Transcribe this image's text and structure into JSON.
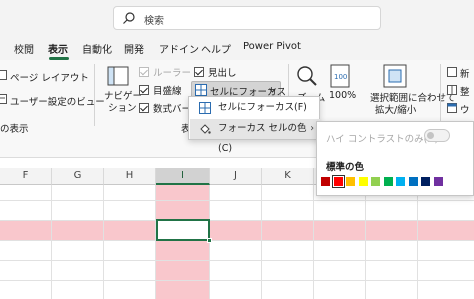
{
  "search": {
    "placeholder": "検索"
  },
  "tabs": [
    {
      "label": "校閲",
      "active": false
    },
    {
      "label": "表示",
      "active": true
    },
    {
      "label": "自動化",
      "active": false
    },
    {
      "label": "開発",
      "active": false
    },
    {
      "label": "アドイン",
      "active": false
    },
    {
      "label": "ヘルプ",
      "active": false
    },
    {
      "label": "Power Pivot",
      "active": false
    }
  ],
  "ribbon": {
    "page_layout": "ページ レイアウト",
    "custom_view": "ユーザー設定のビュー",
    "views_group": "の表示",
    "navigation": [
      "ナビゲー",
      "ション"
    ],
    "ruler": "ルーラー",
    "gridlines": "目盛線",
    "formula_bar": "数式バー",
    "headings": "見出し",
    "cell_focus": "セルにフォーカス",
    "show_group_partial": "表",
    "zoom": "ズーム",
    "zoom_100": "100%",
    "zoom_selection": [
      "選択範囲に合わせて",
      "拡大/縮小"
    ],
    "new_window_partial": "新",
    "arrange_partial": "整",
    "window_partial": "ウ",
    "checkbox_states": {
      "ruler": true,
      "gridlines": true,
      "formula_bar": true,
      "headings": true
    }
  },
  "menu": {
    "items": [
      {
        "label": "セルにフォーカス(F)"
      },
      {
        "label": "フォーカス セルの色(C)"
      }
    ],
    "arrow": "›"
  },
  "submenu": {
    "high_contrast_only": "ハイ コントラストのみ(H)",
    "standard_colors_label": "標準の色",
    "standard_colors": [
      "#c00000",
      "#ff0000",
      "#ffc000",
      "#ffff00",
      "#92d050",
      "#00b050",
      "#00b0f0",
      "#0070c0",
      "#002060",
      "#7030a0"
    ],
    "selected_index": 1
  },
  "columns": [
    "F",
    "G",
    "H",
    "I",
    "J",
    "K"
  ],
  "selected_column": "I",
  "colors": {
    "accent": "#217346",
    "focus": "#f9c7cc"
  }
}
